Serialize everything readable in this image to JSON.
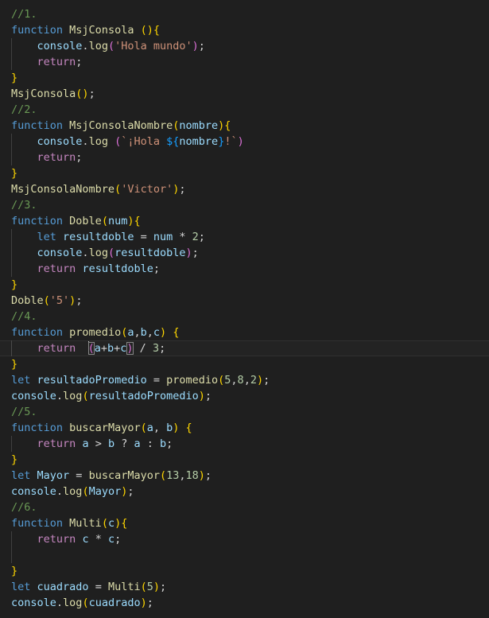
{
  "editor": {
    "name": "code-editor",
    "language": "JavaScript",
    "theme": "Dark Modern",
    "background_color": "#1f1f1f",
    "active_line_color": "#232323",
    "indent_guide_color": "#404040",
    "colors": {
      "comment": "#6a9955",
      "keyword": "#569cd6",
      "control": "#c586c0",
      "function": "#dcdcaa",
      "variable": "#9cdcfe",
      "string": "#ce9178",
      "number": "#b5cea8",
      "operator": "#d4d4d4",
      "bracket_gold": "#ffd700",
      "bracket_magenta": "#da70d6",
      "bracket_blue": "#179fff",
      "bracket_match_outline": "#888888"
    },
    "cursor_line": 27,
    "cursor_column": 13
  },
  "code": {
    "full_text": "//1.\nfunction MsjConsola (){\n    console.log('Hola mundo');\n    return;\n}\nMsjConsola();\n//2.\nfunction MsjConsolaNombre(nombre){\n    console.log (`¡Hola ${nombre}!`)\n    return;\n}\nMsjConsolaNombre('Victor');\n//3.\nfunction Doble(num){\n    let resultdoble = num * 2;\n    console.log(resultdoble);\n    return resultdoble;\n}\nDoble('5');\n//4.\nfunction promedio(a,b,c) {\n    return  (a+b+c) / 3;\n}\nlet resultadoPromedio = promedio(5,8,2);\nconsole.log(resultadoPromedio);\n//5.\nfunction buscarMayor(a, b) {\n    return a > b ? a : b;\n}\nlet Mayor = buscarMayor(13,18);\nconsole.log(Mayor);\n//6.\nfunction Multi(c){\n    return c * c;\n\n}\nlet cuadrado = Multi(5);\nconsole.log(cuadrado);",
    "lines": [
      "//1.",
      "function MsjConsola (){",
      "    console.log('Hola mundo');",
      "    return;",
      "}",
      "MsjConsola();",
      "//2.",
      "function MsjConsolaNombre(nombre){",
      "    console.log (`¡Hola ${nombre}!`)",
      "    return;",
      "}",
      "MsjConsolaNombre('Victor');",
      "//3.",
      "function Doble(num){",
      "    let resultdoble = num * 2;",
      "    console.log(resultdoble);",
      "    return resultdoble;",
      "}",
      "Doble('5');",
      "//4.",
      "function promedio(a,b,c) {",
      "    return  (a+b+c) / 3;",
      "}",
      "let resultadoPromedio = promedio(5,8,2);",
      "console.log(resultadoPromedio);",
      "//5.",
      "function buscarMayor(a, b) {",
      "    return a > b ? a : b;",
      "}",
      "let Mayor = buscarMayor(13,18);",
      "console.log(Mayor);",
      "//6.",
      "function Multi(c){",
      "    return c * c;",
      "",
      "}",
      "let cuadrado = Multi(5);",
      "console.log(cuadrado);"
    ]
  }
}
